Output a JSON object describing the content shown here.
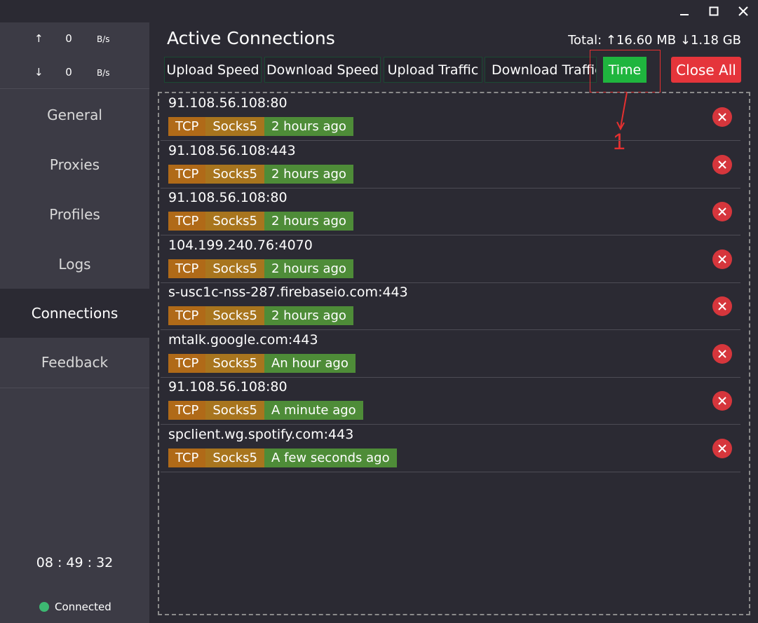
{
  "window": {
    "icons": [
      "minimize-icon",
      "maximize-icon",
      "close-icon"
    ]
  },
  "sidebar": {
    "upload": {
      "arrow": "↑",
      "value": "0",
      "unit": "B/s"
    },
    "download": {
      "arrow": "↓",
      "value": "0",
      "unit": "B/s"
    },
    "nav": [
      {
        "label": "General"
      },
      {
        "label": "Proxies"
      },
      {
        "label": "Profiles"
      },
      {
        "label": "Logs"
      },
      {
        "label": "Connections",
        "active": true
      },
      {
        "label": "Feedback"
      }
    ],
    "clock": "08 : 49 : 32",
    "status": "Connected",
    "status_color": "#3db872"
  },
  "main": {
    "title": "Active Connections",
    "total": "Total: ↑16.60 MB ↓1.18 GB",
    "sort_buttons": [
      {
        "label": "Upload Speed"
      },
      {
        "label": "Download Speed"
      },
      {
        "label": "Upload Traffic"
      },
      {
        "label": "Download Traffic"
      },
      {
        "label": "Time",
        "active": true
      }
    ],
    "close_all": "Close All",
    "annotation_label": "1",
    "connections": [
      {
        "host": "91.108.56.108:80",
        "network": "TCP",
        "type": "Socks5",
        "time": "2 hours ago"
      },
      {
        "host": "91.108.56.108:443",
        "network": "TCP",
        "type": "Socks5",
        "time": "2 hours ago"
      },
      {
        "host": "91.108.56.108:80",
        "network": "TCP",
        "type": "Socks5",
        "time": "2 hours ago"
      },
      {
        "host": "104.199.240.76:4070",
        "network": "TCP",
        "type": "Socks5",
        "time": "2 hours ago"
      },
      {
        "host": "s-usc1c-nss-287.firebaseio.com:443",
        "network": "TCP",
        "type": "Socks5",
        "time": "2 hours ago"
      },
      {
        "host": "mtalk.google.com:443",
        "network": "TCP",
        "type": "Socks5",
        "time": "An hour ago"
      },
      {
        "host": "91.108.56.108:80",
        "network": "TCP",
        "type": "Socks5",
        "time": "A minute ago"
      },
      {
        "host": "spclient.wg.spotify.com:443",
        "network": "TCP",
        "type": "Socks5",
        "time": "A few seconds ago"
      }
    ]
  },
  "colors": {
    "accent_green": "#1fb53e",
    "danger_red": "#e5353b",
    "tag_network": "#b06a18",
    "tag_type": "#a8751e",
    "tag_time": "#4e8c38"
  }
}
